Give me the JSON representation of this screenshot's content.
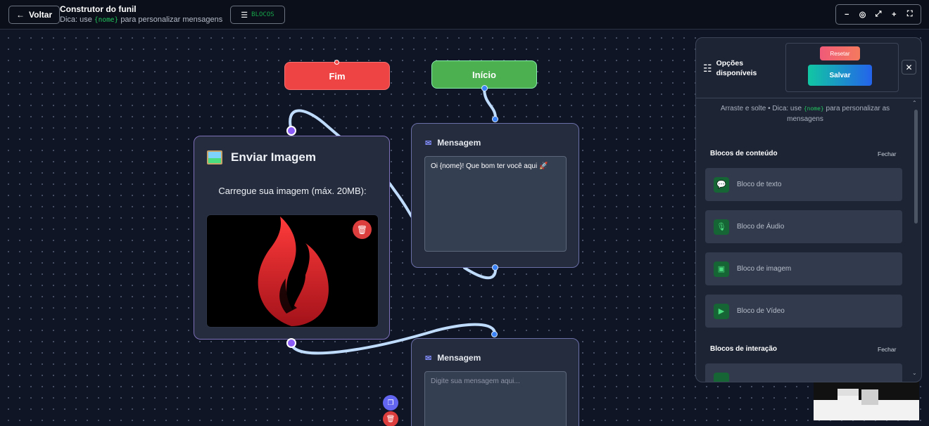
{
  "topbar": {
    "back_label": "Voltar",
    "title": "Construtor do funil",
    "hint_prefix": "Dica: use",
    "hint_code": "{nome}",
    "hint_suffix": "para personalizar mensagens",
    "blocks_label": "BLOCOS",
    "tools": [
      "−",
      "◎",
      "⤢",
      "+",
      "⛶"
    ]
  },
  "nodes": {
    "end_label": "Fim",
    "start_label": "Início",
    "image_card": {
      "title": "Enviar Imagem",
      "subtitle": "Carregue sua imagem (máx. 20MB):"
    },
    "message_1": {
      "title": "Mensagem",
      "text": "Oi {nome}! Que bom ter você aqui 🚀"
    },
    "message_2": {
      "title": "Mensagem",
      "placeholder": "Digite sua mensagem aqui..."
    }
  },
  "panel": {
    "title": "Opções disponíveis",
    "reset_label": "Resetar",
    "save_label": "Salvar",
    "hint_prefix": "Arraste e solte • Dica: use",
    "hint_code": "{nome}",
    "hint_suffix": "para personalizar as mensagens",
    "content_section": {
      "title": "Blocos de conteúdo",
      "close_label": "Fechar",
      "items": [
        {
          "label": "Bloco de texto",
          "icon": "chat-icon"
        },
        {
          "label": "Bloco de Áudio",
          "icon": "mic-icon"
        },
        {
          "label": "Bloco de imagem",
          "icon": "image-icon"
        },
        {
          "label": "Bloco de Vídeo",
          "icon": "video-icon"
        }
      ]
    },
    "interaction_section": {
      "title": "Blocos de interação",
      "close_label": "Fechar"
    }
  },
  "colors": {
    "end_node": "#ef4444",
    "start_node": "#4caf50",
    "edge": "#bfdbfe",
    "accent_purple": "#8b5cf6",
    "accent_green_code": "#22c55e"
  }
}
